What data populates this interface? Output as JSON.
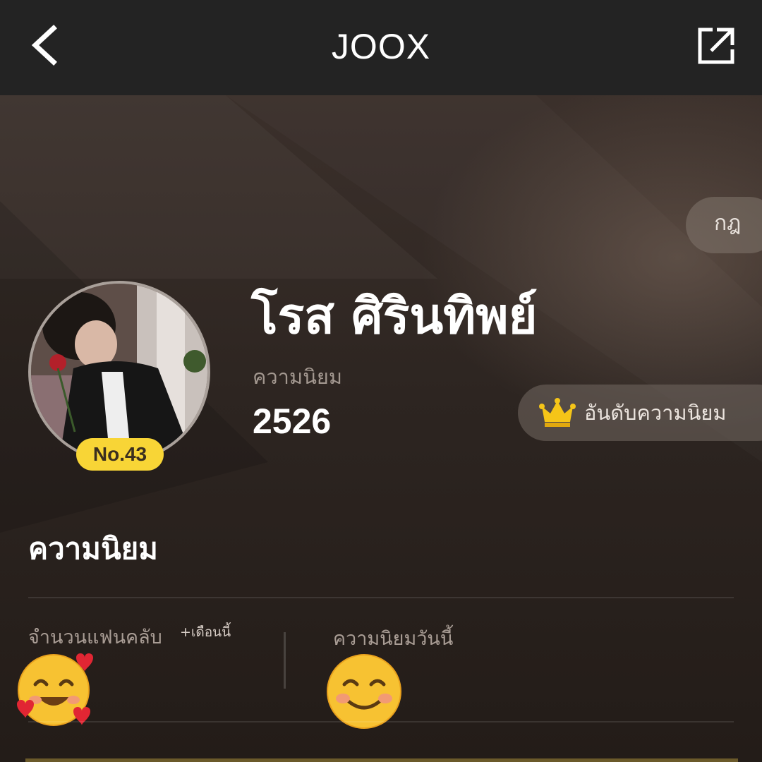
{
  "topbar": {
    "title": "JOOX",
    "back_icon": "chevron-left-icon",
    "share_icon": "external-share-icon"
  },
  "hero": {
    "rules_label": "กฎ",
    "artist_name": "โรส ศิรินทิพย์",
    "popularity_label": "ความนิยม",
    "popularity_value": "2526",
    "rank_badge": "No.43",
    "ranking_button_label": "อันดับความนิยม",
    "ranking_icon": "crown-icon"
  },
  "popularity_section": {
    "title": "ความนิยม",
    "fan_count_label": "จำนวนแฟนคลับ",
    "fan_count_suffix": "+เดือนนี้",
    "fan_count_icon": "smiling-face-with-hearts-emoji",
    "today_label": "ความนิยมวันนี้",
    "today_icon": "smiling-face-emoji"
  },
  "colors": {
    "topbar": "#232323",
    "badge": "#f8d536",
    "crown": "#f5c518"
  }
}
